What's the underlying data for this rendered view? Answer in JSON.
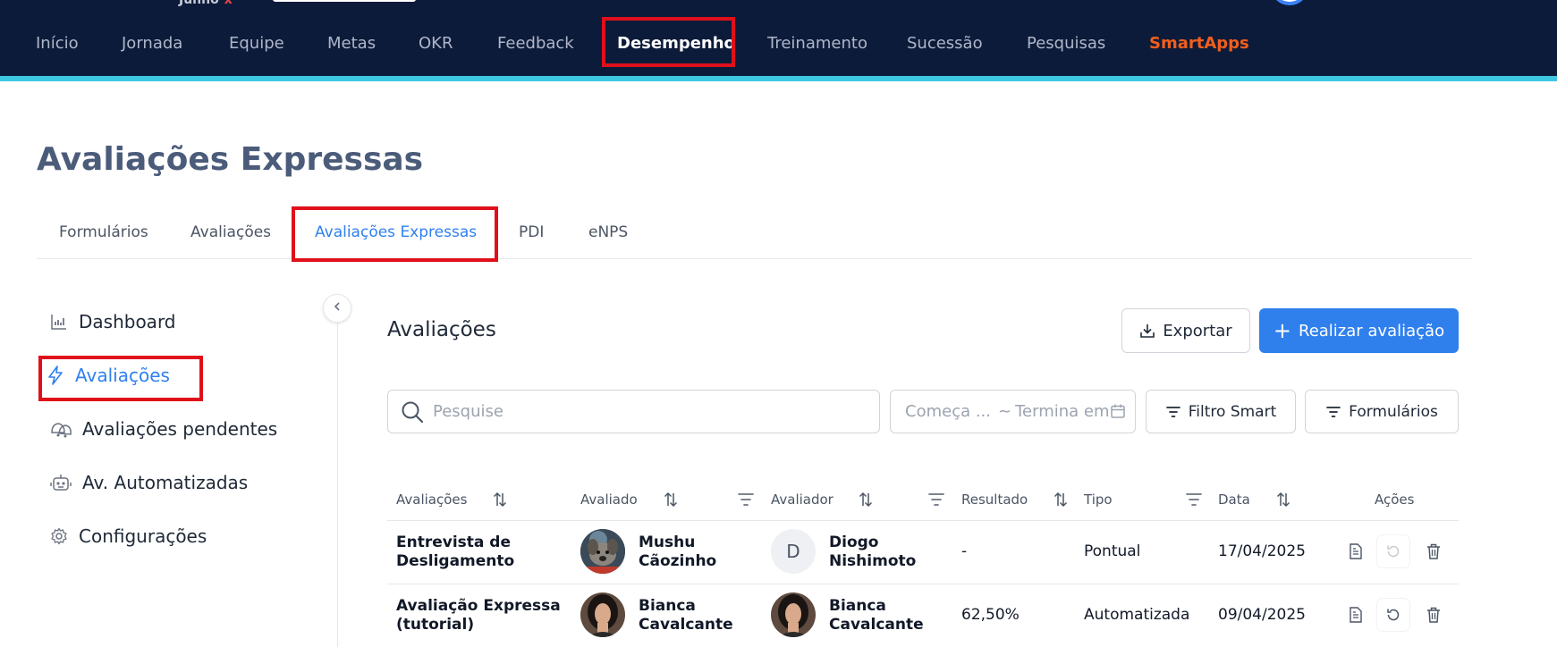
{
  "topbar": {
    "logo_text": "Junho",
    "logo_x": "x",
    "nav": [
      {
        "label": "Início"
      },
      {
        "label": "Jornada"
      },
      {
        "label": "Equipe"
      },
      {
        "label": "Metas"
      },
      {
        "label": "OKR"
      },
      {
        "label": "Feedback"
      },
      {
        "label": "Desempenho"
      },
      {
        "label": "Treinamento"
      },
      {
        "label": "Sucessão"
      },
      {
        "label": "Pesquisas"
      },
      {
        "label": "SmartApps"
      }
    ],
    "active": "Desempenho",
    "colors": {
      "background": "#0d1b3a",
      "accent": "#3ec8e0",
      "smartapps": "#f25f1c",
      "highlight": "#e0101b"
    }
  },
  "page": {
    "title": "Avaliações Expressas"
  },
  "tabs": [
    {
      "label": "Formulários"
    },
    {
      "label": "Avaliações"
    },
    {
      "label": "Avaliações Expressas"
    },
    {
      "label": "PDI"
    },
    {
      "label": "eNPS"
    }
  ],
  "active_tab": "Avaliações Expressas",
  "sidebar": {
    "items": [
      {
        "label": "Dashboard",
        "icon": "chart-icon"
      },
      {
        "label": "Avaliações",
        "icon": "lightning-icon"
      },
      {
        "label": "Avaliações pendentes",
        "icon": "bells-icon"
      },
      {
        "label": "Av. Automatizadas",
        "icon": "robot-icon"
      },
      {
        "label": "Configurações",
        "icon": "gear-icon"
      }
    ],
    "active": "Avaliações",
    "collapse_icon": "chevron-left-icon"
  },
  "main": {
    "section_title": "Avaliações",
    "export_label": "Exportar",
    "primary_label": "Realizar avaliação",
    "search": {
      "placeholder": "Pesquise"
    },
    "date_range": {
      "start_placeholder": "Começa ...",
      "separator": "~",
      "end_placeholder": "Termina em"
    },
    "filters": [
      {
        "label": "Filtro Smart"
      },
      {
        "label": "Formulários"
      }
    ],
    "accent_color": "#2f80ed"
  },
  "table": {
    "columns": [
      {
        "label": "Avaliações",
        "sortable": true,
        "filterable": false
      },
      {
        "label": "Avaliado",
        "sortable": true,
        "filterable": true
      },
      {
        "label": "Avaliador",
        "sortable": true,
        "filterable": true
      },
      {
        "label": "Resultado",
        "sortable": true,
        "filterable": false
      },
      {
        "label": "Tipo",
        "sortable": false,
        "filterable": true
      },
      {
        "label": "Data",
        "sortable": true,
        "filterable": false
      },
      {
        "label": "Ações",
        "sortable": false,
        "filterable": false
      }
    ],
    "rows": [
      {
        "name_line1": "Entrevista de",
        "name_line2": "Desligamento",
        "evaluated_line1": "Mushu",
        "evaluated_line2": "Cãozinho",
        "evaluated_avatar": "dog-photo-avatar",
        "evaluator_line1": "Diogo",
        "evaluator_line2": "Nishimoto",
        "evaluator_initial": "D",
        "result": "-",
        "type": "Pontual",
        "date": "17/04/2025",
        "reopen_enabled": false
      },
      {
        "name_line1": "Avaliação Expressa",
        "name_line2": "(tutorial)",
        "evaluated_line1": "Bianca",
        "evaluated_line2": "Cavalcante",
        "evaluated_avatar": "woman-photo-avatar",
        "evaluator_line1": "Bianca",
        "evaluator_line2": "Cavalcante",
        "evaluator_avatar": "woman-photo-avatar",
        "result": "62,50%",
        "type": "Automatizada",
        "date": "09/04/2025",
        "reopen_enabled": true
      }
    ]
  }
}
